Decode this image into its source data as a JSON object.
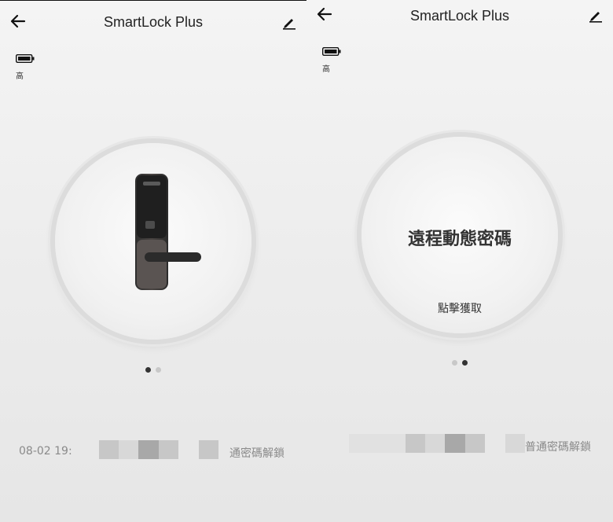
{
  "app": {
    "title": "SmartLock Plus"
  },
  "battery": {
    "level_label": "高",
    "icon": "battery-icon"
  },
  "left": {
    "dial": {
      "content": "lock-illustration"
    },
    "log": {
      "time": "08-02 19:",
      "text": "通密碼解鎖"
    }
  },
  "right": {
    "dial": {
      "title": "遠程動態密碼",
      "action": "點擊獲取"
    },
    "log": {
      "text": "普通密碼解鎖"
    }
  },
  "pager": {
    "pages": 2
  },
  "colors": {
    "accent": "#333333",
    "dot_inactive": "#c8c8c8"
  }
}
